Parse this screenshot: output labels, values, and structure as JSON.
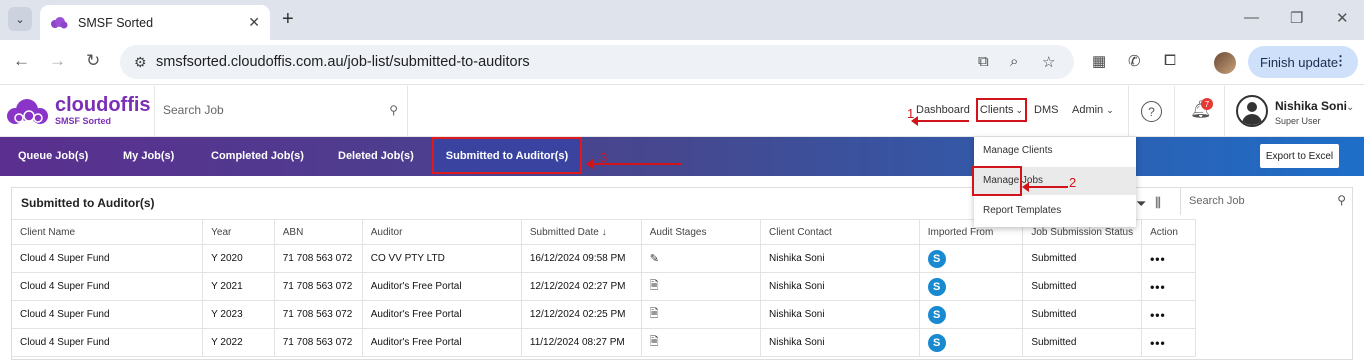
{
  "browser": {
    "tab_title": "SMSF Sorted",
    "url": "smsfsorted.cloudoffis.com.au/job-list/submitted-to-auditors",
    "finish_update": "Finish update"
  },
  "app": {
    "brand": "cloudoffis",
    "sub_brand": "SMSF Sorted",
    "search_placeholder": "Search Job",
    "nav": {
      "dashboard": "Dashboard",
      "clients": "Clients",
      "dms": "DMS",
      "admin": "Admin"
    },
    "notifications": "7",
    "user": {
      "name": "Nishika Soni",
      "role": "Super User"
    }
  },
  "tabs": {
    "queue": "Queue Job(s)",
    "my": "My Job(s)",
    "completed": "Completed Job(s)",
    "deleted": "Deleted Job(s)",
    "submitted": "Submitted to Auditor(s)",
    "export": "Export to Excel"
  },
  "dropdown": {
    "items": [
      "Manage Clients",
      "Manage Jobs",
      "Report Templates"
    ]
  },
  "table": {
    "title": "Submitted to Auditor(s)",
    "search_placeholder": "Search Job",
    "columns": [
      "Client Name",
      "Year",
      "ABN",
      "Auditor",
      "Submitted Date",
      "Audit Stages",
      "Client Contact",
      "Imported From",
      "Job Submission Status",
      "Action"
    ],
    "rows": [
      {
        "client": "Cloud 4 Super Fund",
        "year": "Y 2020",
        "abn": "71 708 563 072",
        "auditor": "CO VV PTY LTD",
        "date": "16/12/2024 09:58 PM",
        "contact": "Nishika Soni",
        "status": "Submitted"
      },
      {
        "client": "Cloud 4 Super Fund",
        "year": "Y 2021",
        "abn": "71 708 563 072",
        "auditor": "Auditor's Free Portal",
        "date": "12/12/2024 02:27 PM",
        "contact": "Nishika Soni",
        "status": "Submitted"
      },
      {
        "client": "Cloud 4 Super Fund",
        "year": "Y 2023",
        "abn": "71 708 563 072",
        "auditor": "Auditor's Free Portal",
        "date": "12/12/2024 02:25 PM",
        "contact": "Nishika Soni",
        "status": "Submitted"
      },
      {
        "client": "Cloud 4 Super Fund",
        "year": "Y 2022",
        "abn": "71 708 563 072",
        "auditor": "Auditor's Free Portal",
        "date": "11/12/2024 08:27 PM",
        "contact": "Nishika Soni",
        "status": "Submitted"
      }
    ]
  },
  "annotations": {
    "one": "1",
    "two": "2",
    "three": "3"
  }
}
